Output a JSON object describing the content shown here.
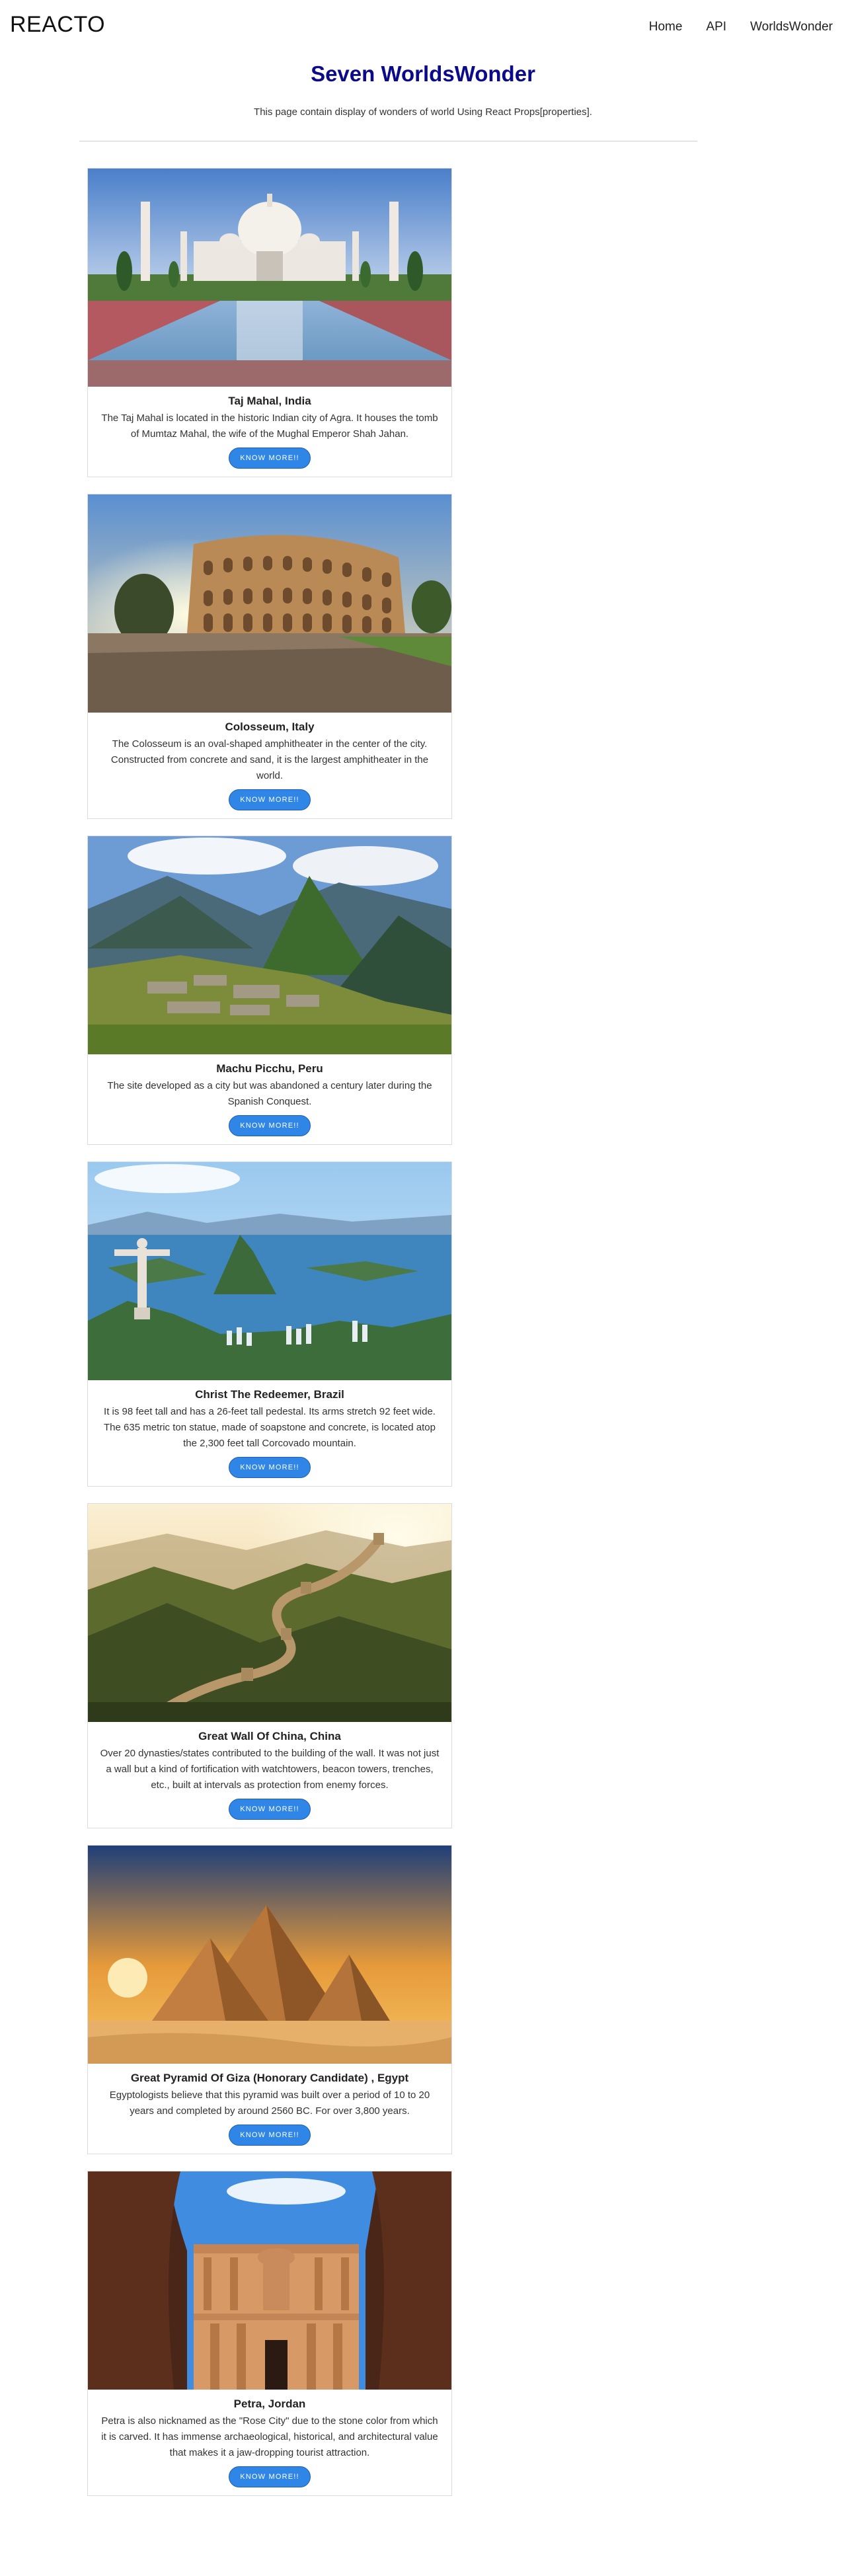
{
  "nav": {
    "brand": "REACTO",
    "links": [
      "Home",
      "API",
      "WorldsWonder"
    ]
  },
  "hero": {
    "title": "Seven WorldsWonder",
    "subtitle": "This page contain display of wonders of world Using React Props[properties]."
  },
  "cards": [
    {
      "title": "Taj Mahal, India",
      "text": "The Taj Mahal is located in the historic Indian city of Agra. It houses the tomb of Mumtaz Mahal, the wife of the Mughal Emperor Shah Jahan.",
      "button": "KNOW MORE!!"
    },
    {
      "title": "Colosseum, Italy",
      "text": "The Colosseum is an oval-shaped amphitheater in the center of the city. Constructed from concrete and sand, it is the largest amphitheater in the world.",
      "button": "KNOW MORE!!"
    },
    {
      "title": "Machu Picchu, Peru",
      "text": "The site developed as a city but was abandoned a century later during the Spanish Conquest.",
      "button": "KNOW MORE!!"
    },
    {
      "title": "Christ The Redeemer, Brazil",
      "text": "It is 98 feet tall and has a 26-feet tall pedestal. Its arms stretch 92 feet wide. The 635 metric ton statue, made of soapstone and concrete, is located atop the 2,300 feet tall Corcovado mountain.",
      "button": "KNOW MORE!!"
    },
    {
      "title": "Great Wall Of China, China",
      "text": "Over 20 dynasties/states contributed to the building of the wall. It was not just a wall but a kind of fortification with watchtowers, beacon towers, trenches, etc., built at intervals as protection from enemy forces.",
      "button": "KNOW MORE!!"
    },
    {
      "title": "Great Pyramid Of Giza (Honorary Candidate) , Egypt",
      "text": "Egyptologists believe that this pyramid was built over a period of 10 to 20 years and completed by around 2560 BC. For over 3,800 years.",
      "button": "KNOW MORE!!"
    },
    {
      "title": "Petra, Jordan",
      "text": "Petra is also nicknamed as the \"Rose City\" due to the stone color from which it is carved. It has immense archaeological, historical, and architectural value that makes it a jaw-dropping tourist attraction.",
      "button": "KNOW MORE!!"
    }
  ]
}
